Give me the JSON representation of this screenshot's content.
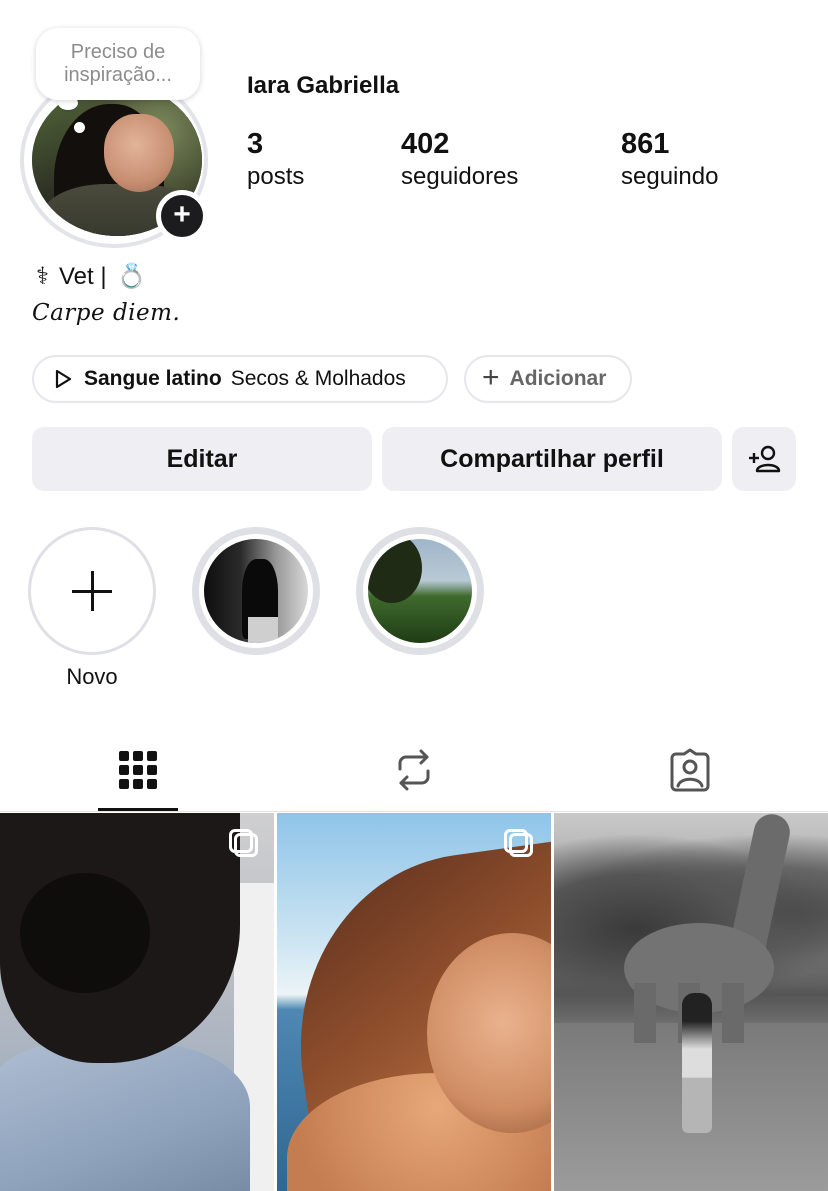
{
  "profile": {
    "note": "Preciso de inspiração...",
    "name": "Iara Gabriella",
    "stats": {
      "posts_count": "3",
      "posts_label": "posts",
      "followers_count": "402",
      "followers_label": "seguidores",
      "following_count": "861",
      "following_label": "seguindo"
    },
    "bio": {
      "line1_prefix_icon": "⚕",
      "line1_text": "Vet |",
      "line1_suffix_icon": "💍",
      "line2": "Carpe diem."
    }
  },
  "music": {
    "song": "Sangue latino",
    "artist": "Secos & Molhados",
    "add_label": "Adicionar"
  },
  "actions": {
    "edit_label": "Editar",
    "share_label": "Compartilhar perfil"
  },
  "highlights": {
    "new_label": "Novo"
  },
  "tabs": {
    "grid": "grid-icon",
    "reposts": "repost-icon",
    "tagged": "tagged-icon"
  }
}
